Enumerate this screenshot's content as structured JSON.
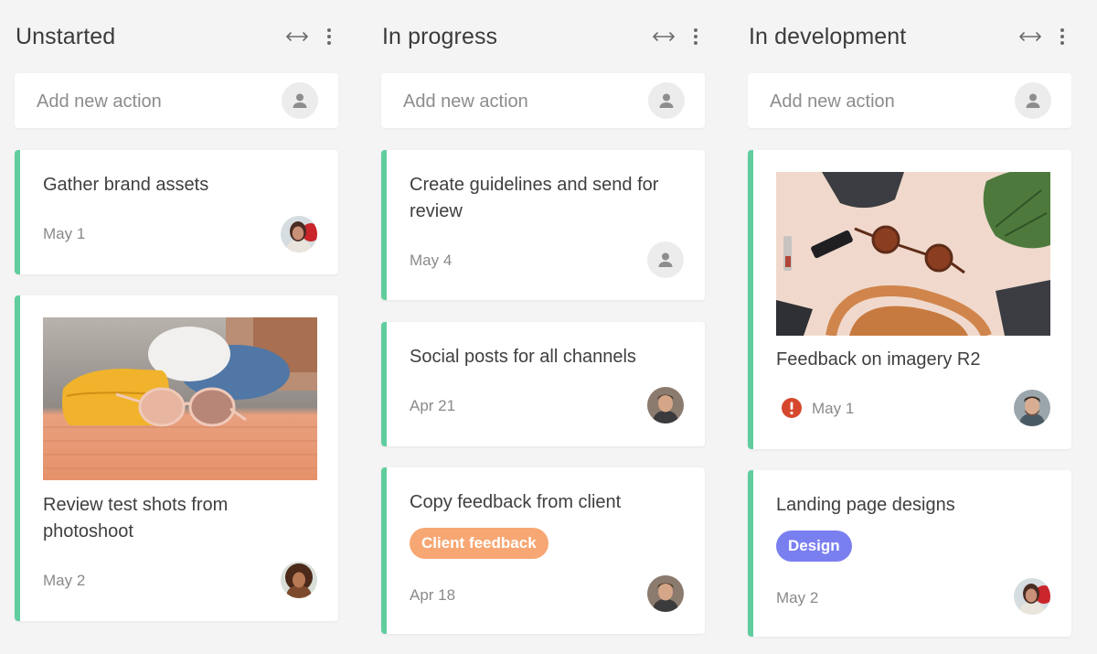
{
  "columns": [
    {
      "title": "Unstarted",
      "add_placeholder": "Add new action",
      "cards": [
        {
          "title": "Gather brand assets",
          "date": "May 1",
          "assignee": "woman-red-hair-avatar"
        },
        {
          "title": "Review test shots from photoshoot",
          "date": "May 2",
          "assignee": "woman-curly-hair-avatar",
          "image": "sunglasses-yellow-case-photo"
        }
      ]
    },
    {
      "title": "In progress",
      "add_placeholder": "Add new action",
      "cards": [
        {
          "title": "Create guidelines and send for review",
          "date": "May 4",
          "assignee": "unassigned"
        },
        {
          "title": "Social posts for all channels",
          "date": "Apr 21",
          "assignee": "man-avatar"
        },
        {
          "title": "Copy feedback from client",
          "date": "Apr 18",
          "assignee": "man-avatar",
          "tag": "Client feedback"
        }
      ]
    },
    {
      "title": "In development",
      "add_placeholder": "Add new action",
      "cards": [
        {
          "title": "Feedback on imagery R2",
          "date": "May 1",
          "assignee": "man-beard-avatar",
          "image": "flatlay-sunglasses-bag-photo",
          "status": "overdue-alert"
        },
        {
          "title": "Landing page designs",
          "date": "May 2",
          "assignee": "woman-red-hair-avatar",
          "tag": "Design"
        }
      ]
    }
  ],
  "colors": {
    "card_accent": "#5fcd9e",
    "tag_client_feedback": "#f7a773",
    "tag_design": "#7a7ff0",
    "alert": "#d6482e",
    "background": "#f4f4f4"
  },
  "icons": {
    "expand": "horizontal-arrows-icon",
    "more": "vertical-dots-icon",
    "unassigned": "person-icon"
  }
}
